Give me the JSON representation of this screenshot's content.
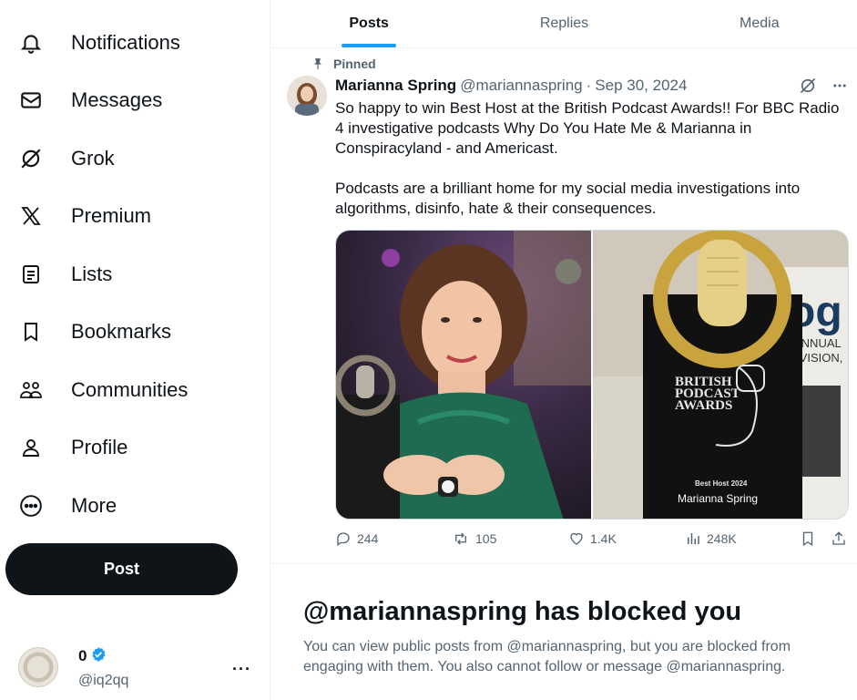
{
  "sidebar": {
    "items": [
      {
        "label": "Notifications",
        "icon": "bell-icon"
      },
      {
        "label": "Messages",
        "icon": "envelope-icon"
      },
      {
        "label": "Grok",
        "icon": "grok-icon"
      },
      {
        "label": "Premium",
        "icon": "x-logo-icon"
      },
      {
        "label": "Lists",
        "icon": "list-icon"
      },
      {
        "label": "Bookmarks",
        "icon": "bookmark-icon"
      },
      {
        "label": "Communities",
        "icon": "people-icon"
      },
      {
        "label": "Profile",
        "icon": "person-icon"
      },
      {
        "label": "More",
        "icon": "more-circle-icon"
      }
    ],
    "post_button": "Post",
    "account": {
      "name": "0",
      "handle": "@iq2qq",
      "verified": true
    }
  },
  "tabs": [
    {
      "label": "Posts",
      "active": true
    },
    {
      "label": "Replies",
      "active": false
    },
    {
      "label": "Media",
      "active": false
    }
  ],
  "post": {
    "pinned_label": "Pinned",
    "author": "Marianna Spring",
    "handle": "@mariannaspring",
    "separator": "·",
    "date": "Sep 30, 2024",
    "text_1": "So happy to win Best Host at the British Podcast Awards!! For BBC Radio 4 investigative podcasts Why Do You Hate Me & Marianna in Conspiracyland - and Americast.",
    "text_2": "Podcasts are a brilliant home for my social media investigations into algorithms, disinfo, hate & their consequences.",
    "media": {
      "award_line_1": "BRITISH",
      "award_line_2": "PODCAST",
      "award_line_3": "AWARDS",
      "award_category": "Best Host 2024",
      "award_winner": "Marianna Spring",
      "background_sign": "og",
      "background_sign_sub_1": "ANNUAL",
      "background_sign_sub_2": "EVISION,"
    },
    "stats": {
      "replies": "244",
      "reposts": "105",
      "likes": "1.4K",
      "views": "248K"
    }
  },
  "blocked": {
    "title": "@mariannaspring has blocked you",
    "description": "You can view public posts from @mariannaspring, but you are blocked from engaging with them. You also cannot follow or message @mariannaspring."
  },
  "colors": {
    "accent": "#1d9bf0",
    "text_primary": "#0f1419",
    "text_secondary": "#536471",
    "post_button_bg": "#0f1419"
  }
}
